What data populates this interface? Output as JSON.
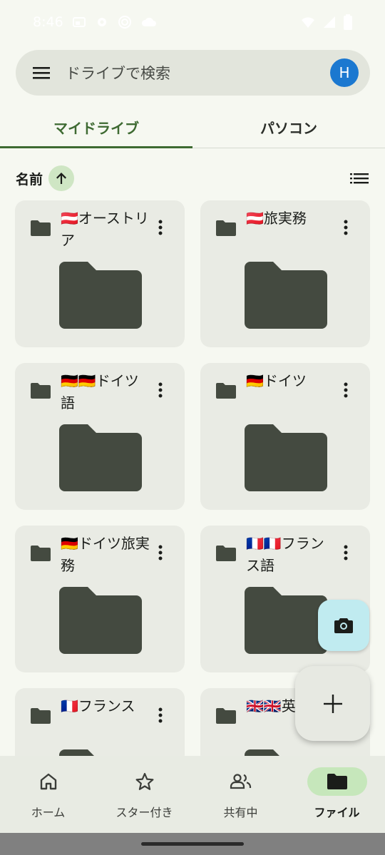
{
  "status": {
    "time": "8:46",
    "left_icons": [
      "cast-icon",
      "settings-gear-icon",
      "target-icon",
      "cloud-icon"
    ],
    "right_icons": [
      "wifi-icon",
      "signal-icon",
      "battery-icon"
    ]
  },
  "search": {
    "placeholder": "ドライブで検索",
    "avatar_initial": "H",
    "avatar_color": "#1b78d0"
  },
  "tabs": [
    {
      "label": "マイドライブ",
      "active": true
    },
    {
      "label": "パソコン",
      "active": false
    }
  ],
  "sort": {
    "label": "名前",
    "direction": "ascending"
  },
  "folders": [
    {
      "title": "🇦🇹オーストリア"
    },
    {
      "title": "🇦🇹旅実務"
    },
    {
      "title": "🇩🇪🇩🇪ドイツ語"
    },
    {
      "title": "🇩🇪ドイツ"
    },
    {
      "title": "🇩🇪ドイツ旅実務"
    },
    {
      "title": "🇫🇷🇫🇷フランス語"
    },
    {
      "title": "🇫🇷フランス"
    },
    {
      "title": "🇬🇧🇬🇧英"
    }
  ],
  "fabs": {
    "camera_icon": "camera-icon",
    "new_icon": "plus-icon",
    "camera_color": "#c0ebf0"
  },
  "bottom_nav": [
    {
      "label": "ホーム",
      "icon": "home-icon",
      "active": false
    },
    {
      "label": "スター付き",
      "icon": "star-icon",
      "active": false
    },
    {
      "label": "共有中",
      "icon": "people-icon",
      "active": false
    },
    {
      "label": "ファイル",
      "icon": "folder-icon",
      "active": true
    }
  ],
  "colors": {
    "accent": "#3e6a32",
    "folder": "#444a40",
    "background": "#f6f8f1"
  }
}
